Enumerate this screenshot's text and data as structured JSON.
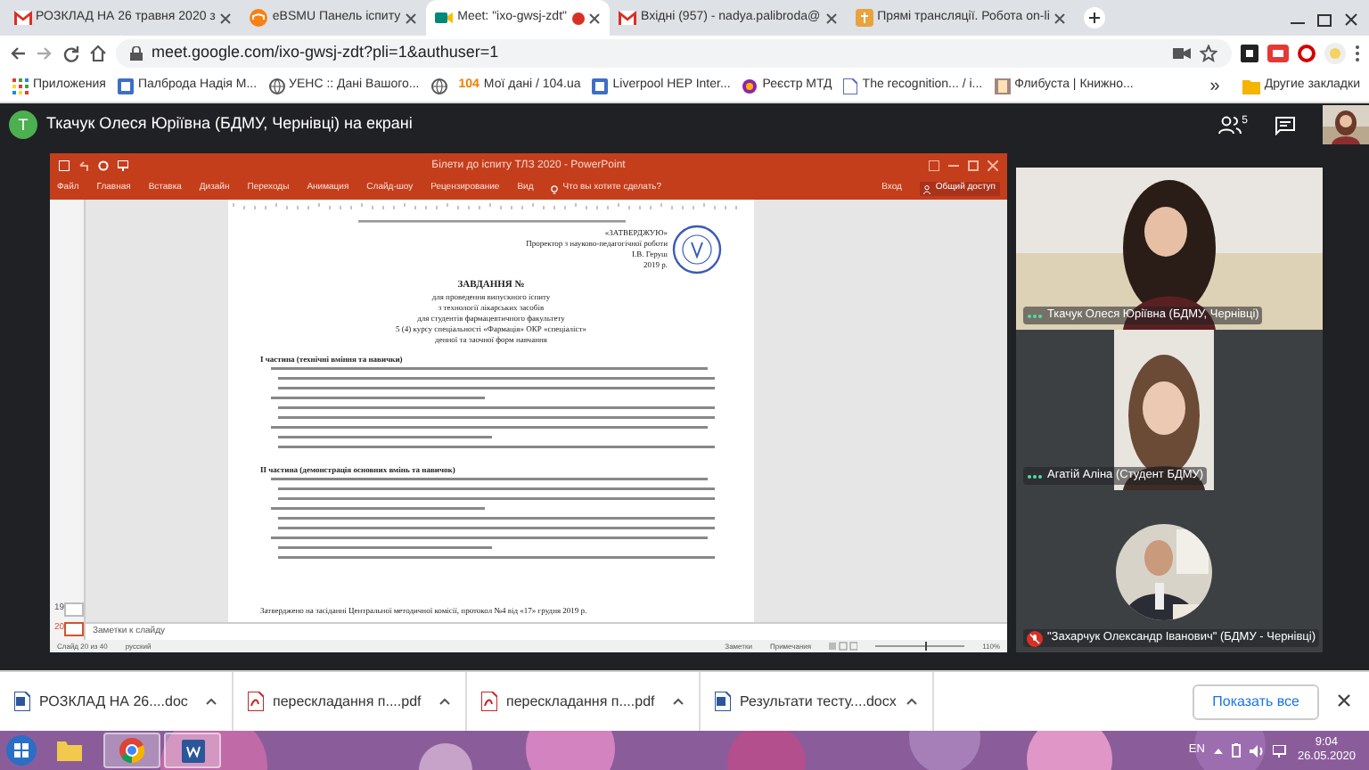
{
  "browser": {
    "tabs": [
      {
        "title": "РОЗКЛАД НА 26 травня 2020 з",
        "kind": "gmail",
        "selected": false,
        "recording": false
      },
      {
        "title": "eBSMU Панель іспиту",
        "kind": "moodle",
        "selected": false,
        "recording": false
      },
      {
        "title": "Meet: \"ixo-gwsj-zdt\"",
        "kind": "meet",
        "selected": true,
        "recording": true
      },
      {
        "title": "Вхідні (957) - nadya.palibroda@",
        "kind": "gmail",
        "selected": false,
        "recording": false
      },
      {
        "title": "Прямі трансляції. Робота on-li",
        "kind": "site",
        "selected": false,
        "recording": false
      }
    ],
    "url": "meet.google.com/ixo-gwsj-zdt?pli=1&authuser=1",
    "bookmarks": [
      {
        "kind": "apps",
        "label": "Приложения"
      },
      {
        "kind": "site",
        "label": "Палброда Надія М..."
      },
      {
        "kind": "globe",
        "label": "УЕНС :: Дані Вашого..."
      },
      {
        "kind": "globe"
      },
      {
        "kind": "badge",
        "badge": "104",
        "label": "Мої дані / 104.ua"
      },
      {
        "kind": "site",
        "label": "Liverpool HEP Inter..."
      },
      {
        "kind": "color",
        "label": "Реєстр МТД"
      },
      {
        "kind": "page",
        "label": "The recognition... / i..."
      },
      {
        "kind": "book",
        "label": "Флибуста | Книжно..."
      }
    ],
    "more": "»",
    "other_bookmarks": "Другие закладки"
  },
  "meet": {
    "avatar_letter": "Т",
    "banner": "Ткачук Олеся Юріївна (БДМУ, Чернівці) на екрані",
    "people_count": "5",
    "presentation": {
      "title": "Білети до іспиту ТЛЗ 2020 - PowerPoint",
      "ribbon_tabs": [
        "Файл",
        "Главная",
        "Вставка",
        "Дизайн",
        "Переходы",
        "Анимация",
        "Слайд-шоу",
        "Рецензирование",
        "Вид"
      ],
      "tell_me": "Что вы хотите сделать?",
      "sign_in": "Вход",
      "share": "Общий доступ",
      "slides": [
        {
          "number": "19",
          "selected": false
        },
        {
          "number": "20",
          "selected": true
        }
      ],
      "notes_hint": "Заметки к слайду",
      "document": {
        "approval": [
          "«ЗАТВЕРДЖУЮ»",
          "Проректор з науково-педагогічної роботи",
          "І.В. Геруш",
          "2019 р."
        ],
        "title_lines": [
          "ЗАВДАННЯ №",
          "для проведення випускного іспиту",
          "з технології лікарських засобів",
          "для студентів фармацевтичного факультету",
          "5 (4) курсу спеціальності «Фармація» ОКР «спеціаліст»",
          "денної та заочної форм навчання"
        ],
        "sections": [
          {
            "heading": "І частина (технічні вміння та навички)"
          },
          {
            "heading": "ІІ частина (демонстрація основних вмінь та навичок)"
          }
        ],
        "footer": "Затверджено на засіданні Центральної методичної комісії, протокол №4 від «17» грудня 2019 р."
      },
      "status": {
        "slide": "Слайд 20 из 40",
        "language": "русский",
        "notes": "Заметки",
        "comments": "Примечания",
        "zoom": {
          "level": 0.55,
          "reading": "110%"
        }
      }
    },
    "tiles": [
      {
        "name": "Ткачук Олеся Юріївна (БДМУ, Чернівці)",
        "kind": "wide",
        "muted": false
      },
      {
        "name": "Агатій Аліна (Студент БДМУ)",
        "kind": "portrait",
        "muted": false
      },
      {
        "name": "\"Захарчук Олександр Іванович\" (БДМУ - Чернівці)",
        "kind": "avatar",
        "muted": true
      }
    ]
  },
  "downloads": {
    "items": [
      {
        "name": "РОЗКЛАД НА 26....doc",
        "kind": "word"
      },
      {
        "name": "перескладання п....pdf",
        "kind": "pdf"
      },
      {
        "name": "перескладання п....pdf",
        "kind": "pdf"
      },
      {
        "name": "Результати тесту....docx",
        "kind": "word"
      }
    ],
    "show_all": "Показать все"
  },
  "taskbar": {
    "apps": [
      {
        "kind": "explorer",
        "running": false
      },
      {
        "kind": "chrome",
        "running": true
      },
      {
        "kind": "word",
        "running": true
      }
    ],
    "language": "EN",
    "time": "9:04",
    "date": "26.05.2020"
  }
}
